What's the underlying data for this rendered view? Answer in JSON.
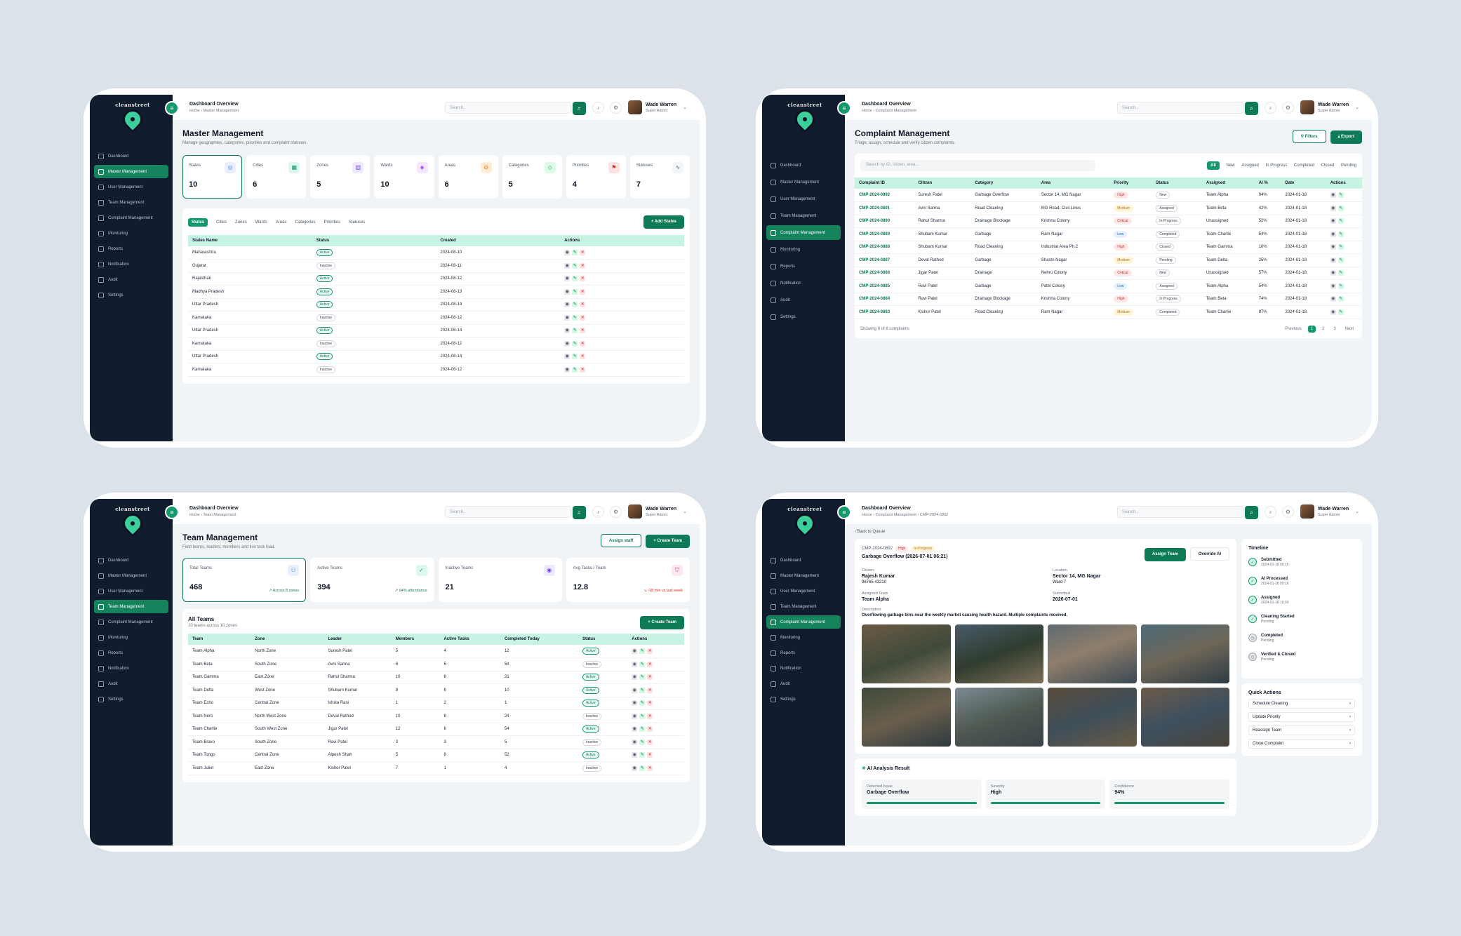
{
  "common": {
    "search_placeholder": "Search...",
    "user_name": "Wade Warren",
    "user_role": "Super Admin",
    "header_title": "Dashboard Overview",
    "logo_text": "cleanstreet",
    "nav": [
      "Dashboard",
      "Master Management",
      "User Management",
      "Team Management",
      "Complaint Management",
      "Monitoring",
      "Reports",
      "Notification",
      "Audit",
      "Settings"
    ]
  },
  "master": {
    "breadcrumb": "Home  ›  Master Management",
    "title": "Master Management",
    "subtitle": "Manage geographies, categories, priorities and complaint statuses.",
    "stats": [
      {
        "label": "States",
        "value": "10"
      },
      {
        "label": "Cities",
        "value": "6"
      },
      {
        "label": "Zones",
        "value": "5"
      },
      {
        "label": "Wards",
        "value": "10"
      },
      {
        "label": "Areas",
        "value": "6"
      },
      {
        "label": "Categories",
        "value": "5"
      },
      {
        "label": "Priorities",
        "value": "4"
      },
      {
        "label": "Statuses",
        "value": "7"
      }
    ],
    "tabs": [
      "States",
      "Cities",
      "Zones",
      "Wards",
      "Areas",
      "Categories",
      "Priorities",
      "Statuses"
    ],
    "add_button": "+ Add States",
    "columns": [
      "States Name",
      "Status",
      "Created",
      "Actions"
    ],
    "rows": [
      [
        "Maharashtra",
        "Active",
        "2024-08-10"
      ],
      [
        "Gujarat",
        "Inactive",
        "2024-08-11"
      ],
      [
        "Rajasthan",
        "Active",
        "2024-08-12"
      ],
      [
        "Madhya Pradesh",
        "Active",
        "2024-08-13"
      ],
      [
        "Uttar Pradesh",
        "Active",
        "2024-08-14"
      ],
      [
        "Karnataka",
        "Inactive",
        "2024-08-12"
      ],
      [
        "Uttar Pradesh",
        "Active",
        "2024-08-14"
      ],
      [
        "Karnataka",
        "Inactive",
        "2024-08-12"
      ],
      [
        "Uttar Pradesh",
        "Active",
        "2024-08-14"
      ],
      [
        "Karnataka",
        "Inactive",
        "2024-08-12"
      ]
    ]
  },
  "complaint": {
    "breadcrumb": "Home  ›  Complaint Management",
    "title": "Complaint Management",
    "subtitle": "Triage, assign, schedule and verify citizen complaints.",
    "filters_button": "Filters",
    "export_button": "Export",
    "search_placeholder": "Search by ID, citizen, area...",
    "chips": [
      "All",
      "New",
      "Assigned",
      "In Progress",
      "Completed",
      "Closed",
      "Pending"
    ],
    "columns": [
      "Complaint ID",
      "Citizen",
      "Category",
      "Area",
      "Priority",
      "Status",
      "Assigned",
      "AI %",
      "Date",
      "Actions"
    ],
    "rows": [
      [
        "CMP-2024-0892",
        "Suresh Patel",
        "Garbage Overflow",
        "Sector 14, MG Nagar",
        "High",
        "New",
        "Team Alpha",
        "94%",
        "2024-01-18"
      ],
      [
        "CMP-2024-0891",
        "Avni Sarma",
        "Road Cleaning",
        "MG Road, Civil Lines",
        "Medium",
        "Assigned",
        "Team Beta",
        "42%",
        "2024-01-18"
      ],
      [
        "CMP-2024-0890",
        "Rahul Sharma",
        "Drainage Blockage",
        "Krishna Colony",
        "Critical",
        "In Progress",
        "Unassigned",
        "52%",
        "2024-01-18"
      ],
      [
        "CMP-2024-0889",
        "Shubam Kumar",
        "Garbage",
        "Ram Nagar",
        "Low",
        "Completed",
        "Team Charlie",
        "54%",
        "2024-01-18"
      ],
      [
        "CMP-2024-0888",
        "Shubam Kumar",
        "Road Cleaning",
        "Industrial Area Ph.2",
        "High",
        "Closed",
        "Team Gamma",
        "10%",
        "2024-01-18"
      ],
      [
        "CMP-2024-0887",
        "Deval Rathod",
        "Garbage",
        "Shastri Nagar",
        "Medium",
        "Pending",
        "Team Delta",
        "25%",
        "2024-01-18"
      ],
      [
        "CMP-2024-0886",
        "Jigar Patel",
        "Drainage",
        "Nehru Colony",
        "Critical",
        "New",
        "Unassigned",
        "57%",
        "2024-01-18"
      ],
      [
        "CMP-2024-0885",
        "Ravi Patel",
        "Garbage",
        "Patel Colony",
        "Low",
        "Assigned",
        "Team Alpha",
        "54%",
        "2024-01-18"
      ],
      [
        "CMP-2024-0884",
        "Ravi Patel",
        "Drainage Blockage",
        "Krishna Colony",
        "High",
        "In Progress",
        "Team Beta",
        "74%",
        "2024-01-18"
      ],
      [
        "CMP-2024-0883",
        "Kishor Patel",
        "Road Cleaning",
        "Ram Nagar",
        "Medium",
        "Completed",
        "Team Charlie",
        "87%",
        "2024-01-18"
      ]
    ],
    "showing": "Showing 8 of 8 complaints",
    "pages": [
      "Previous",
      "1",
      "2",
      "3",
      "Next"
    ]
  },
  "team": {
    "breadcrumb": "Home  ›  Team Management",
    "title": "Team Management",
    "subtitle": "Field teams, leaders, members and live task load.",
    "assign_button": "Assign staff",
    "create_button": "+ Create Team",
    "kpis": [
      {
        "label": "Total Teams",
        "value": "468",
        "trend": "↗ Across 8 zones"
      },
      {
        "label": "Active Teams",
        "value": "394",
        "trend": "↗ 94% attendance"
      },
      {
        "label": "Inactive Teams",
        "value": "21",
        "trend": ""
      },
      {
        "label": "Avg Tasks / Team",
        "value": "12.8",
        "trend": "↘ -18 min vs last week"
      }
    ],
    "list_title": "All Teams",
    "list_sub": "10 teams across 10 zones",
    "list_button": "+ Create Team",
    "columns": [
      "Team",
      "Zone",
      "Leader",
      "Members",
      "Active Tasks",
      "Completed Today",
      "Status",
      "Actions"
    ],
    "rows": [
      [
        "Team Alpha",
        "North Zone",
        "Suresh Patel",
        "5",
        "4",
        "12",
        "Active"
      ],
      [
        "Team Beta",
        "South Zone",
        "Avni Sarma",
        "6",
        "5",
        "54",
        "Inactive"
      ],
      [
        "Team Gamma",
        "East Zone",
        "Rahul Sharma",
        "10",
        "8",
        "21",
        "Active"
      ],
      [
        "Team Delta",
        "West Zone",
        "Shubam Kumar",
        "8",
        "6",
        "10",
        "Active"
      ],
      [
        "Team Echo",
        "Central Zone",
        "Ishika Rani",
        "1",
        "2",
        "1",
        "Active"
      ],
      [
        "Team Nero",
        "North West Zone",
        "Deval Rathod",
        "10",
        "8",
        "24",
        "Inactive"
      ],
      [
        "Team Charlie",
        "South West Zone",
        "Jigar Patel",
        "12",
        "6",
        "54",
        "Active"
      ],
      [
        "Team Bravo",
        "South Zone",
        "Ravi Patel",
        "3",
        "3",
        "5",
        "Inactive"
      ],
      [
        "Team Tongo",
        "Central Zone",
        "Alpesh Shah",
        "5",
        "8",
        "52",
        "Active"
      ],
      [
        "Team Juliet",
        "East Zone",
        "Kishor Patel",
        "7",
        "1",
        "4",
        "Inactive"
      ]
    ]
  },
  "detail": {
    "breadcrumb": "Home  ›  Complaint Management  ›  CMP-2024-0892",
    "back": "‹  Back to Queue",
    "id": "CMP-2024-0892",
    "priority": "High",
    "status": "In-Progress",
    "heading": "Garbage Overflow (2026-07-01 06:21)",
    "assign_button": "Assign Team",
    "override_button": "Override AI",
    "fields": [
      {
        "label": "Citizen",
        "value": "Rajesh Kumar",
        "extra": "98765 43210"
      },
      {
        "label": "Location",
        "value": "Sector 14, MG Nagar",
        "extra": "Ward 7"
      },
      {
        "label": "Assigned Team",
        "value": "Team Alpha",
        "extra": ""
      },
      {
        "label": "Submitted",
        "value": "2026-07-01",
        "extra": ""
      }
    ],
    "desc_label": "Description",
    "description": "Overflowing garbage bins near the weekly market causing health hazard. Multiple complaints received.",
    "timeline_title": "Timeline",
    "timeline": [
      {
        "name": "Submitted",
        "time": "2024-01-18 09:15",
        "done": true
      },
      {
        "name": "AI Processed",
        "time": "2024-01-18 09:16",
        "done": true
      },
      {
        "name": "Assigned",
        "time": "2024-01-18 10:30",
        "done": true
      },
      {
        "name": "Cleaning Started",
        "time": "Pending",
        "done": true
      },
      {
        "name": "Completed",
        "time": "Pending",
        "done": false
      },
      {
        "name": "Verified & Closed",
        "time": "Pending",
        "done": false
      }
    ],
    "quick_title": "Quick Actions",
    "quick": [
      "Schedule Cleaning",
      "Update Priority",
      "Reassign Team",
      "Close Complaint"
    ],
    "ai_title": "AI Analysis Result",
    "ai": [
      {
        "label": "Detected Issue",
        "value": "Garbage Overflow"
      },
      {
        "label": "Severity",
        "value": "High"
      },
      {
        "label": "Confidence",
        "value": "94%"
      }
    ]
  }
}
